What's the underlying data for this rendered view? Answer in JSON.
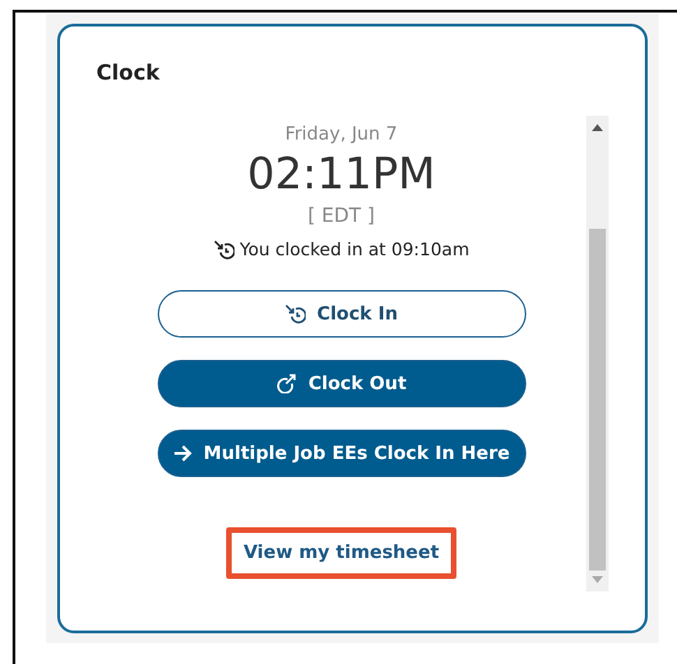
{
  "card": {
    "title": "Clock"
  },
  "clock": {
    "date": "Friday, Jun 7",
    "time": "02:11PM",
    "timezone": "[ EDT ]",
    "status": "You clocked in at 09:10am"
  },
  "buttons": [
    {
      "label": "Clock In",
      "kind": "clockin"
    },
    {
      "label": "Clock Out",
      "kind": "clockout"
    },
    {
      "label": "Multiple Job EEs Clock In Here",
      "kind": "multijob"
    }
  ],
  "link": {
    "label": "View my timesheet",
    "highlighted": true
  }
}
